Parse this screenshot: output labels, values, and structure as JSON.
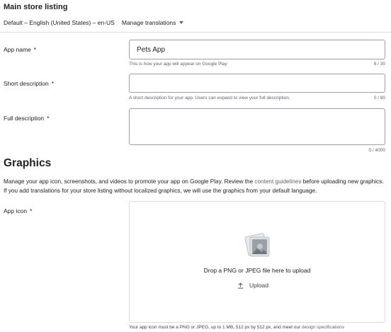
{
  "listing": {
    "title": "Main store listing",
    "language": "Default – English (United States) – en-US",
    "manage_translations": "Manage translations"
  },
  "fields": {
    "app_name": {
      "label": "App name",
      "required": "*",
      "value": "Pets App",
      "helper": "This is how your app will appear on Google Play",
      "counter": "8 / 30"
    },
    "short_description": {
      "label": "Short description",
      "required": "*",
      "value": "",
      "helper": "A short description for your app. Users can expand to view your full description.",
      "counter": "0 / 80"
    },
    "full_description": {
      "label": "Full description",
      "required": "*",
      "value": "",
      "counter": "0 / 4000"
    }
  },
  "graphics": {
    "title": "Graphics",
    "desc_part1": "Manage your app icon, screenshots, and videos to promote your app on Google Play. Review the ",
    "desc_link": "content guidelines",
    "desc_part2": " before uploading new graphics. If you add translations for your store listing without localized graphics, we will use the graphics from your default language.",
    "app_icon": {
      "label": "App icon",
      "required": "*",
      "drop_text": "Drop a PNG or JPEG file here to upload",
      "upload_label": "Upload",
      "footnote_text": "Your app icon must be a PNG or JPEG, up to 1 MB, 512 px by 512 px, and meet our ",
      "footnote_link": "design specifications"
    }
  },
  "icons": [
    "chevron-down-icon",
    "image-placeholder-icon",
    "upload-icon"
  ]
}
